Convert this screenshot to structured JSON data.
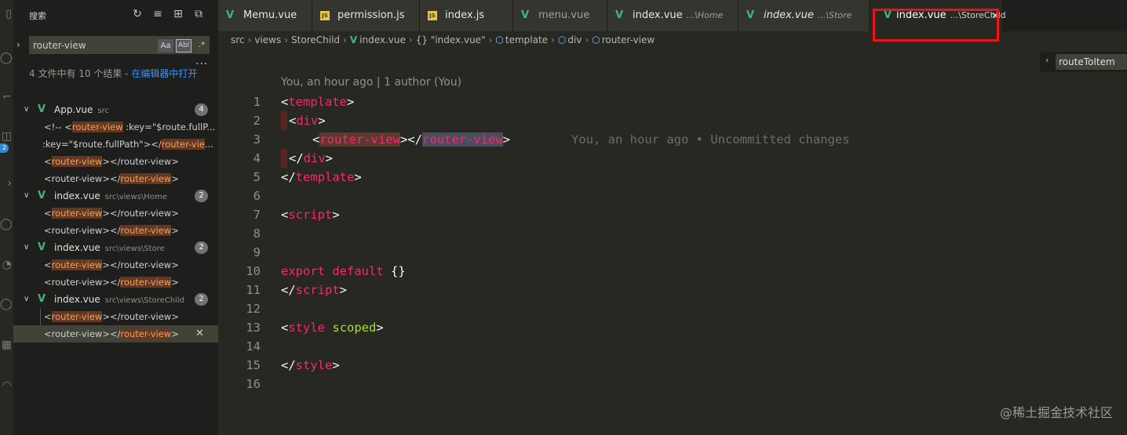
{
  "sidebar": {
    "title": "搜索",
    "search": {
      "value": "router-view",
      "opt_case": "Aa",
      "opt_word": "Abl",
      "opt_regex": ".*"
    },
    "more": "...",
    "results_text": "4 文件中有 10 个结果 - ",
    "results_link": "在编辑器中打开",
    "files": [
      {
        "name": "App.vue",
        "path": "src",
        "count": "4",
        "matches": [
          {
            "pre": "<!-- <",
            "hit": "router-view",
            "post": " :key=\"$route.fullP..."
          },
          {
            "pre": ":key=\"$route.fullPath\"></",
            "hit": "router-vie",
            "post": "..."
          },
          {
            "pre": "<",
            "hit": "router-view",
            "post": "></router-view>"
          },
          {
            "pre": "<router-view></",
            "hit": "router-view",
            "post": ">"
          }
        ]
      },
      {
        "name": "index.vue",
        "path": "src\\views\\Home",
        "count": "2",
        "matches": [
          {
            "pre": "<",
            "hit": "router-view",
            "post": "></router-view>"
          },
          {
            "pre": "<router-view></",
            "hit": "router-view",
            "post": ">"
          }
        ]
      },
      {
        "name": "index.vue",
        "path": "src\\views\\Store",
        "count": "2",
        "matches": [
          {
            "pre": "<",
            "hit": "router-view",
            "post": "></router-view>"
          },
          {
            "pre": "<router-view></",
            "hit": "router-view",
            "post": ">"
          }
        ]
      },
      {
        "name": "index.vue",
        "path": "src\\views\\StoreChild",
        "count": "2",
        "matches": [
          {
            "pre": "<",
            "hit": "router-view",
            "post": "></router-view>"
          },
          {
            "pre": "<router-view></",
            "hit": "router-view",
            "post": ">"
          }
        ]
      }
    ],
    "activity_badge": "2"
  },
  "tabs": [
    {
      "label": "Memu.vue",
      "path": "",
      "icon": "V",
      "type": "vue"
    },
    {
      "label": "permission.js",
      "path": "",
      "icon": "JS",
      "type": "js"
    },
    {
      "label": "index.js",
      "path": "",
      "icon": "JS",
      "type": "js"
    },
    {
      "label": "menu.vue",
      "path": "",
      "icon": "V",
      "type": "vue"
    },
    {
      "label": "index.vue",
      "path": "...\\Home",
      "icon": "V",
      "type": "vue"
    },
    {
      "label": "index.vue",
      "path": "...\\Store",
      "icon": "V",
      "type": "vue"
    },
    {
      "label": "index.vue",
      "path": "...\\StoreChild",
      "icon": "V",
      "type": "vue"
    }
  ],
  "breadcrumb": {
    "b1": "src",
    "b2": "views",
    "b3": "StoreChild",
    "b4": "index.vue",
    "b5": "\"index.vue\"",
    "b5_icon": "{}",
    "b6": "template",
    "b7": "div",
    "b8": "router-view"
  },
  "outline": {
    "item": "routeToItem"
  },
  "editor": {
    "blame_header": "You, an hour ago | 1 author (You)",
    "blame_inline": "You, an hour ago • Uncommitted changes",
    "line_numbers": [
      "1",
      "2",
      "3",
      "4",
      "5",
      "6",
      "7",
      "8",
      "9",
      "10",
      "11",
      "12",
      "13",
      "14",
      "15",
      "16"
    ],
    "code": {
      "l1_tag": "template",
      "l2_tag": "div",
      "l3_tag_open": "router-view",
      "l3_tag_close": "router-view",
      "l4_tag": "div",
      "l5_tag": "template",
      "l7_tag": "script",
      "l10_kw1": "export",
      "l10_kw2": "default",
      "l10_brace": "{}",
      "l11_tag": "script",
      "l13_tag": "style",
      "l13_attr": "scoped",
      "l15_tag": "style"
    }
  },
  "watermark": "@稀土掘金技术社区",
  "colors": {
    "accent_vue": "#41b883",
    "highlight_box": "#e8131b",
    "tag": "#f92672",
    "attr": "#a6e22e"
  }
}
